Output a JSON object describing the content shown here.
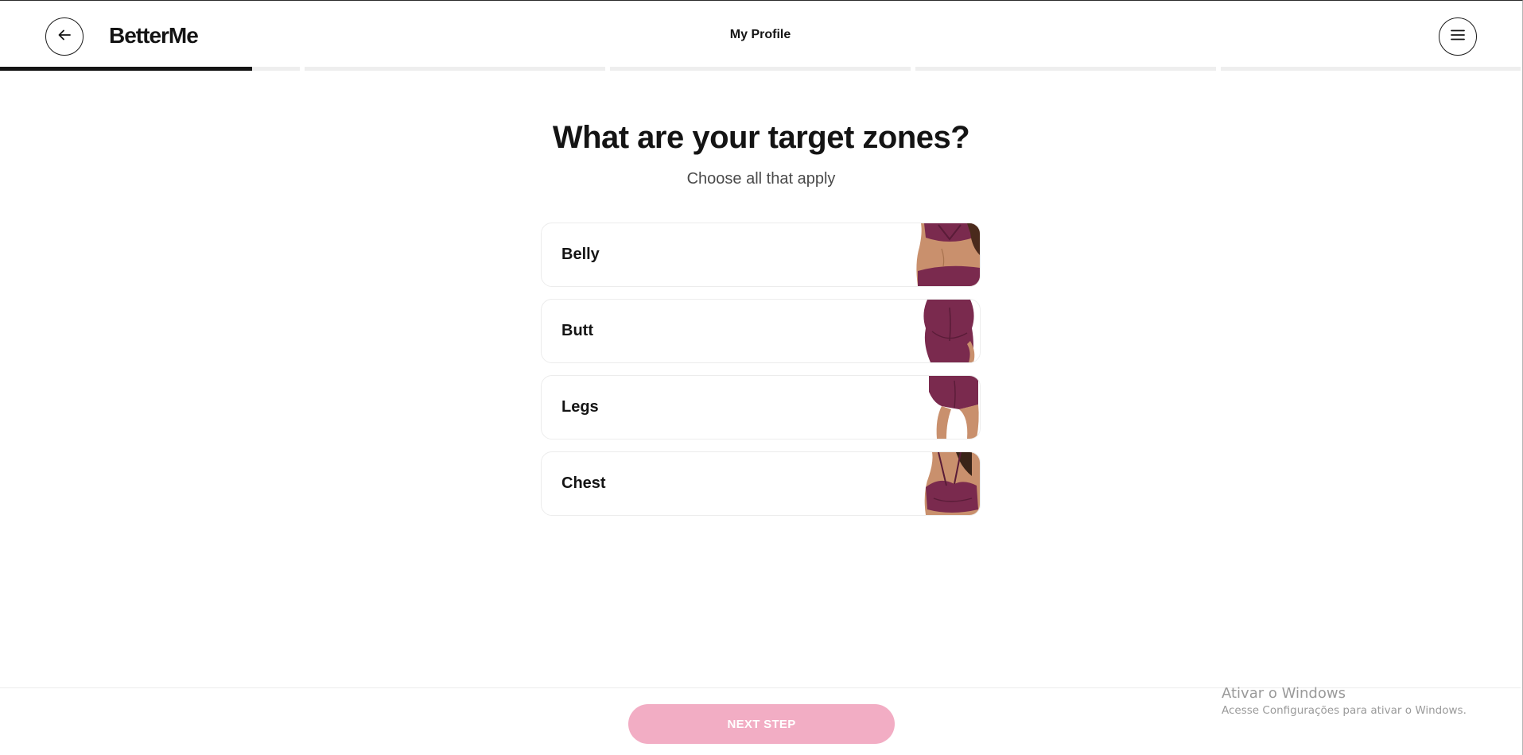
{
  "header": {
    "logo": "BetterMe",
    "title": "My Profile",
    "back_icon": "arrow-left-icon",
    "menu_icon": "hamburger-menu-icon"
  },
  "progress": {
    "total_segments": 5,
    "current_segment": 1,
    "current_segment_fill": 0.84
  },
  "question": {
    "title": "What are your target zones?",
    "subtitle": "Choose all that apply"
  },
  "options": [
    {
      "label": "Belly",
      "icon": "belly-zone-photo"
    },
    {
      "label": "Butt",
      "icon": "butt-zone-photo"
    },
    {
      "label": "Legs",
      "icon": "legs-zone-photo"
    },
    {
      "label": "Chest",
      "icon": "chest-zone-photo"
    }
  ],
  "footer": {
    "next_label": "NEXT STEP"
  },
  "watermark": {
    "title": "Ativar o Windows",
    "subtitle": "Acesse Configurações para ativar o Windows."
  },
  "colors": {
    "text": "#141414",
    "progress_fill": "#141414",
    "progress_track": "#eeeeee",
    "outfit": "#7a2a4e",
    "button_disabled": "#f2adc4"
  }
}
